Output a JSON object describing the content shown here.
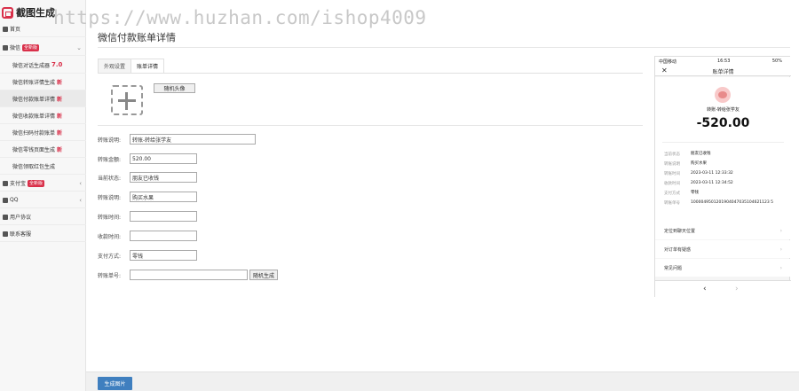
{
  "app": {
    "title": "截图生成"
  },
  "watermark": "https://www.huzhan.com/ishop4009",
  "sidebar": {
    "home": "首页",
    "wechat": {
      "label": "微信",
      "badge": "全新版"
    },
    "wechat_items": [
      {
        "label": "微信对话生成器",
        "tag": "",
        "version": "7.0"
      },
      {
        "label": "微信转账详情生成",
        "tag": "新",
        "version": ""
      },
      {
        "label": "微信付款账单详情",
        "tag": "新",
        "version": ""
      },
      {
        "label": "微信收款账单详情",
        "tag": "新",
        "version": ""
      },
      {
        "label": "微信扫码付款账单",
        "tag": "新",
        "version": ""
      },
      {
        "label": "微信零钱页面生成",
        "tag": "新",
        "version": ""
      },
      {
        "label": "微信领取红包生成",
        "tag": "",
        "version": ""
      }
    ],
    "alipay": {
      "label": "支付宝",
      "badge": "全新版"
    },
    "qq": "QQ",
    "agreement": "用户协议",
    "contact": "联系客服"
  },
  "page": {
    "title": "微信付款账单详情"
  },
  "tabs": [
    {
      "label": "外观设置",
      "active": false
    },
    {
      "label": "账单详情",
      "active": true
    }
  ],
  "form": {
    "random_avatar_button": "随机头像",
    "fields": [
      {
        "label": "转账说明:",
        "value": "转账-转给张学友"
      },
      {
        "label": "转账金额:",
        "value": "520.00"
      },
      {
        "label": "当前状态:",
        "value": "朋友已收钱"
      },
      {
        "label": "转账说明:",
        "value": "购买水果"
      },
      {
        "label": "转账时间:",
        "value": ""
      },
      {
        "label": "收款时间:",
        "value": ""
      },
      {
        "label": "支付方式:",
        "value": "零钱"
      },
      {
        "label": "转账单号:",
        "value": ""
      }
    ],
    "generate_button": "随机生成"
  },
  "footer": {
    "generate_image": "生成图片"
  },
  "phone": {
    "carrier": "中国移动",
    "time": "16:53",
    "battery": "50%",
    "title": "账单详情",
    "name": "转账-转给张学友",
    "amount": "-520.00",
    "rows": [
      {
        "key": "当前状态",
        "value": "朋友已收钱"
      },
      {
        "key": "转账说明",
        "value": "购买水果"
      },
      {
        "key": "转账时间",
        "value": "2023-03-11 12:33:32"
      },
      {
        "key": "收款时间",
        "value": "2023-03-11 12:34:52"
      },
      {
        "key": "支付方式",
        "value": "零钱"
      },
      {
        "key": "转账单号",
        "value": "1000049501201904047035104621123 5"
      }
    ],
    "links": [
      "定位到聊天位置",
      "对订单有疑惑",
      "常见问题"
    ],
    "nav_back": "‹",
    "nav_forward": "›"
  }
}
